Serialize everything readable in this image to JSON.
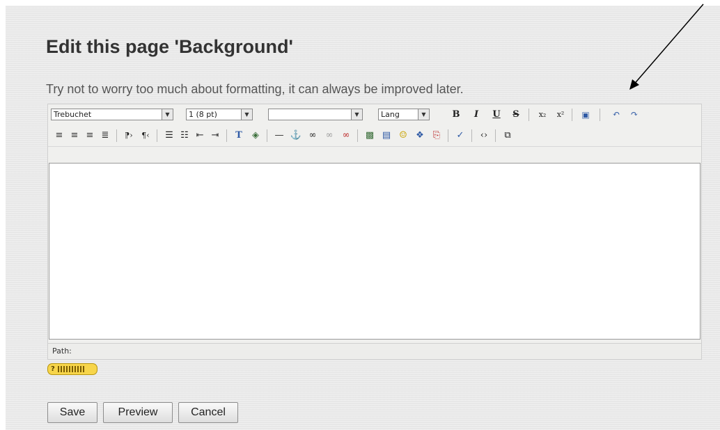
{
  "page": {
    "title": "Edit this page 'Background'",
    "instructions": "Try not to worry too much about formatting, it can always be improved later."
  },
  "editor": {
    "font_select": "Trebuchet",
    "size_select": "1 (8 pt)",
    "format_select": "",
    "lang_select": "Lang",
    "bold": "B",
    "italic": "I",
    "underline": "U",
    "strikethrough": "S",
    "subscript": "x₂",
    "superscript": "x²",
    "undo": "↶",
    "redo": "↷",
    "statusbar": "Path:",
    "content": ""
  },
  "help": {
    "label": "?"
  },
  "buttons": {
    "save": "Save",
    "preview": "Preview",
    "cancel": "Cancel"
  },
  "colors": {
    "background": "#ebebeb",
    "help_badge": "#f7d54a",
    "arrow": "#000000"
  },
  "icons": [
    "align-left-icon",
    "align-center-icon",
    "align-right-icon",
    "justify-icon",
    "ltr-icon",
    "rtl-icon",
    "ordered-list-icon",
    "unordered-list-icon",
    "outdent-icon",
    "indent-icon",
    "text-color-icon",
    "background-color-icon",
    "horizontal-rule-icon",
    "anchor-icon",
    "link-icon",
    "unlink-icon",
    "nolink-icon",
    "image-icon",
    "table-icon",
    "smiley-icon",
    "special-char-icon",
    "search-replace-icon",
    "spellcheck-icon",
    "html-source-icon",
    "fullscreen-icon",
    "clean-word-icon",
    "annotation-arrow"
  ]
}
